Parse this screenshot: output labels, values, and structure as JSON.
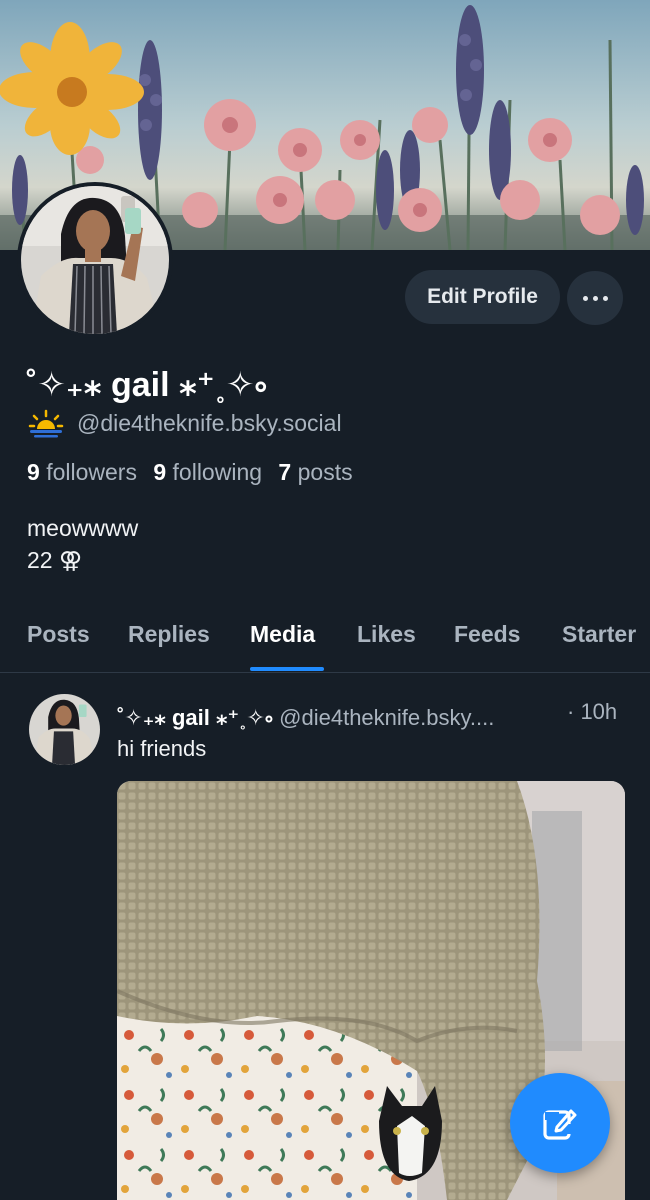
{
  "profile": {
    "display_name": "˚✧₊⁎ gail ⁎⁺˳✧༚",
    "handle_icon": "sunrise-emoji",
    "handle": "@die4theknife.bsky.social",
    "stats": {
      "followers_count": "9",
      "followers_label": "followers",
      "following_count": "9",
      "following_label": "following",
      "posts_count": "7",
      "posts_label": "posts"
    },
    "bio_line1": "meowwww",
    "bio_line2": "22 ⚢"
  },
  "actions": {
    "edit_profile_label": "Edit Profile",
    "more_icon": "ellipsis-icon"
  },
  "tabs": [
    {
      "label": "Posts"
    },
    {
      "label": "Replies"
    },
    {
      "label": "Media",
      "active": true
    },
    {
      "label": "Likes"
    },
    {
      "label": "Feeds"
    },
    {
      "label": "Starter"
    }
  ],
  "post": {
    "author_name": "˚✧₊⁎ gail ⁎⁺˳✧༚",
    "author_handle": "@die4theknife.bsky....",
    "time": "· 10h",
    "text": "hi friends"
  },
  "fab": {
    "icon": "compose-icon"
  },
  "colors": {
    "background": "#161e27",
    "accent": "#208bfe",
    "button_bg": "#26313d",
    "muted_text": "#aab4bf"
  }
}
